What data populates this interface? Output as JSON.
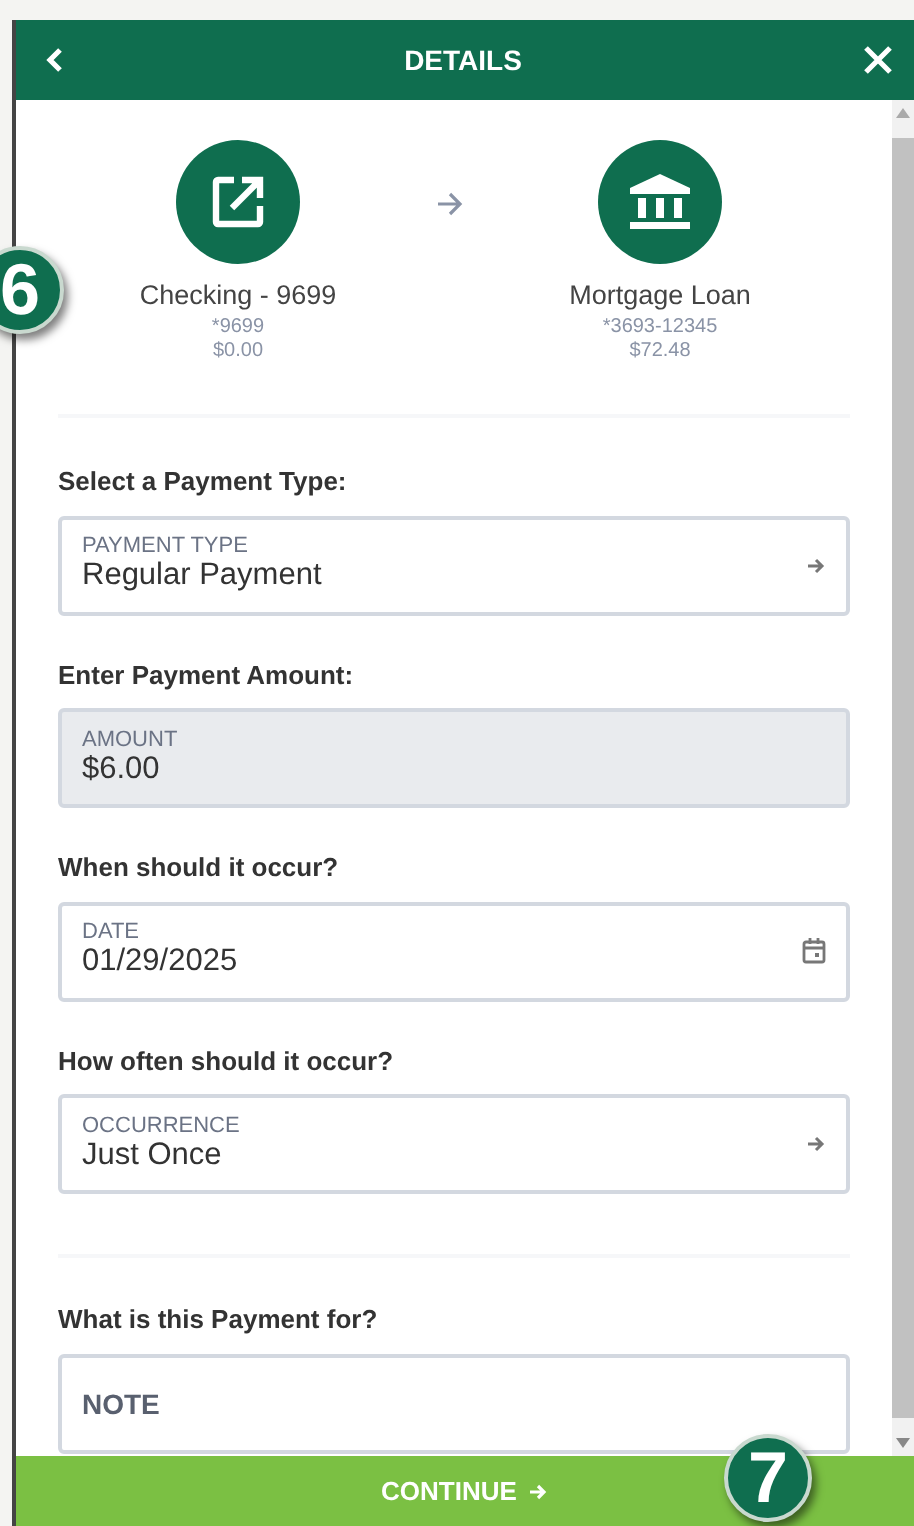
{
  "header": {
    "title": "DETAILS"
  },
  "transfer": {
    "from": {
      "name": "Checking - 9699",
      "number": "*9699",
      "balance": "$0.00"
    },
    "to": {
      "name": "Mortgage Loan",
      "number": "*3693-12345",
      "balance": "$72.48"
    }
  },
  "sections": [
    {
      "label": "Select a Payment Type:",
      "field": {
        "kind": "select",
        "caption": "PAYMENT TYPE",
        "value": "Regular Payment",
        "disabled": false
      }
    },
    {
      "label": "Enter Payment Amount:",
      "field": {
        "kind": "amount",
        "caption": "AMOUNT",
        "value": "$6.00",
        "disabled": true
      }
    },
    {
      "label": "When should it occur?",
      "field": {
        "kind": "date",
        "caption": "DATE",
        "value": "01/29/2025",
        "disabled": false
      }
    },
    {
      "label": "How often should it occur?",
      "field": {
        "kind": "select",
        "caption": "OCCURRENCE",
        "value": "Just Once",
        "disabled": false
      }
    }
  ],
  "note_section": {
    "label": "What is this Payment for?",
    "placeholder": "NOTE"
  },
  "continue_button": {
    "label": "CONTINUE"
  },
  "callouts": [
    "6",
    "7"
  ]
}
